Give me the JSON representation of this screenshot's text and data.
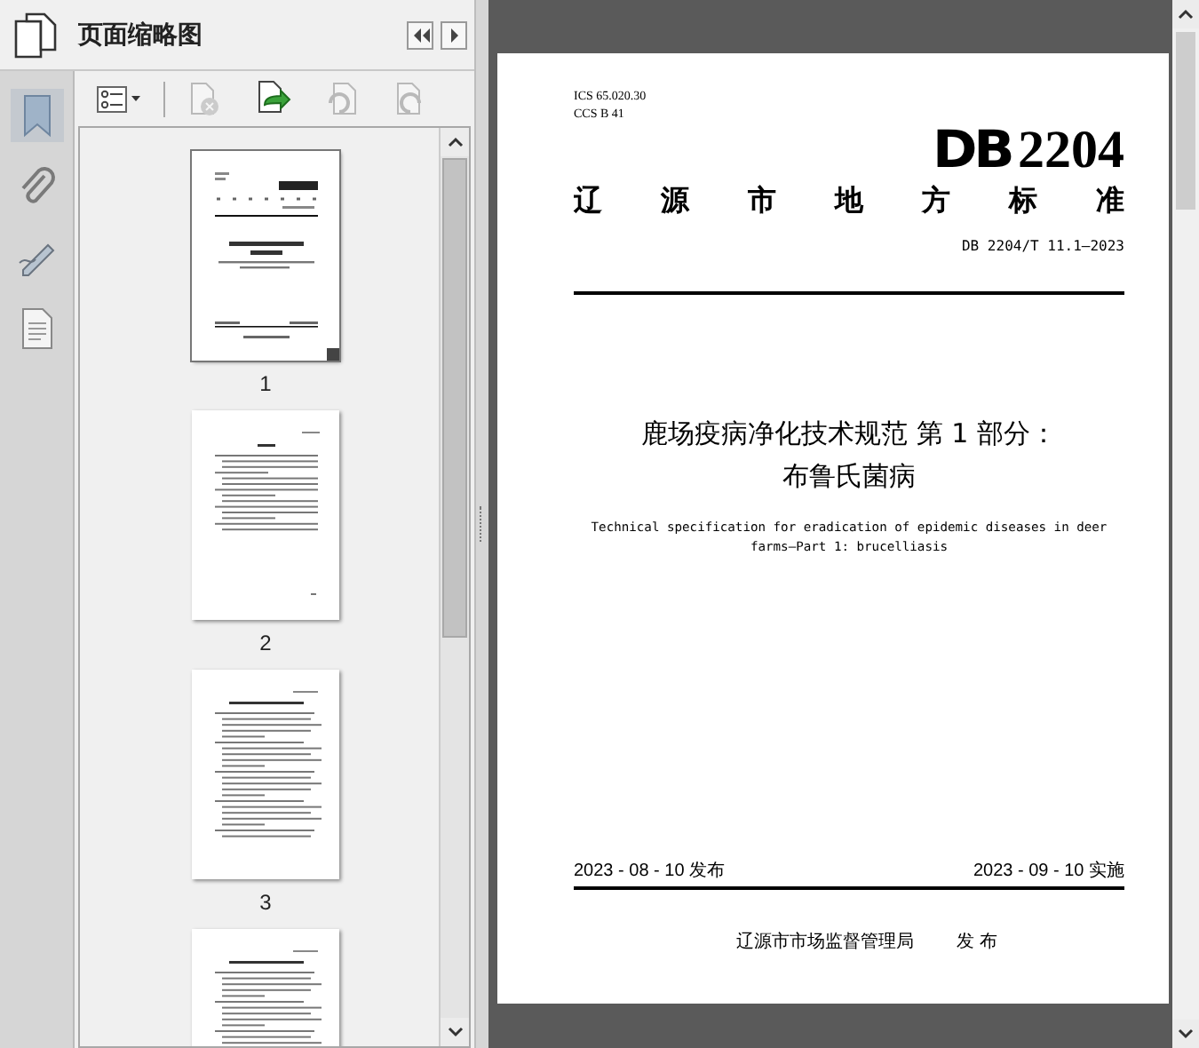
{
  "sidebar": {
    "title": "页面缩略图",
    "nav_rail": [
      {
        "kind": "bookmark",
        "selected": true
      },
      {
        "kind": "attachment",
        "selected": false
      },
      {
        "kind": "signature",
        "selected": false
      },
      {
        "kind": "layers",
        "selected": false
      }
    ],
    "toolbar": [
      {
        "kind": "options",
        "disabled": false
      },
      {
        "kind": "delete",
        "disabled": true
      },
      {
        "kind": "replace",
        "disabled": false
      },
      {
        "kind": "rotate-left",
        "disabled": true
      },
      {
        "kind": "rotate-right",
        "disabled": true
      }
    ],
    "thumbnails": [
      {
        "label": "1",
        "kind": "cover",
        "selected": true
      },
      {
        "label": "2",
        "kind": "foreword",
        "selected": false
      },
      {
        "label": "3",
        "kind": "body",
        "selected": false
      },
      {
        "kind": "body",
        "selected": false
      }
    ]
  },
  "document": {
    "ics": "ICS 65.020.30",
    "ccs": "CCS B 41",
    "logo": "DB",
    "code": "2204",
    "standard_type": "辽源市地方标准",
    "number": "DB 2204/T 11.1—2023",
    "title_lines": [
      "鹿场疫病净化技术规范 第 1 部分：",
      "布鲁氏菌病"
    ],
    "title_en": "Technical specification for eradication of epidemic diseases in deer\nfarms—Part 1: brucelliasis",
    "issue_date": "2023 - 08 - 10 发布",
    "effective_date": "2023 - 09 - 10 实施",
    "publisher": "辽源市市场监督管理局",
    "publish_label": "发 布"
  }
}
